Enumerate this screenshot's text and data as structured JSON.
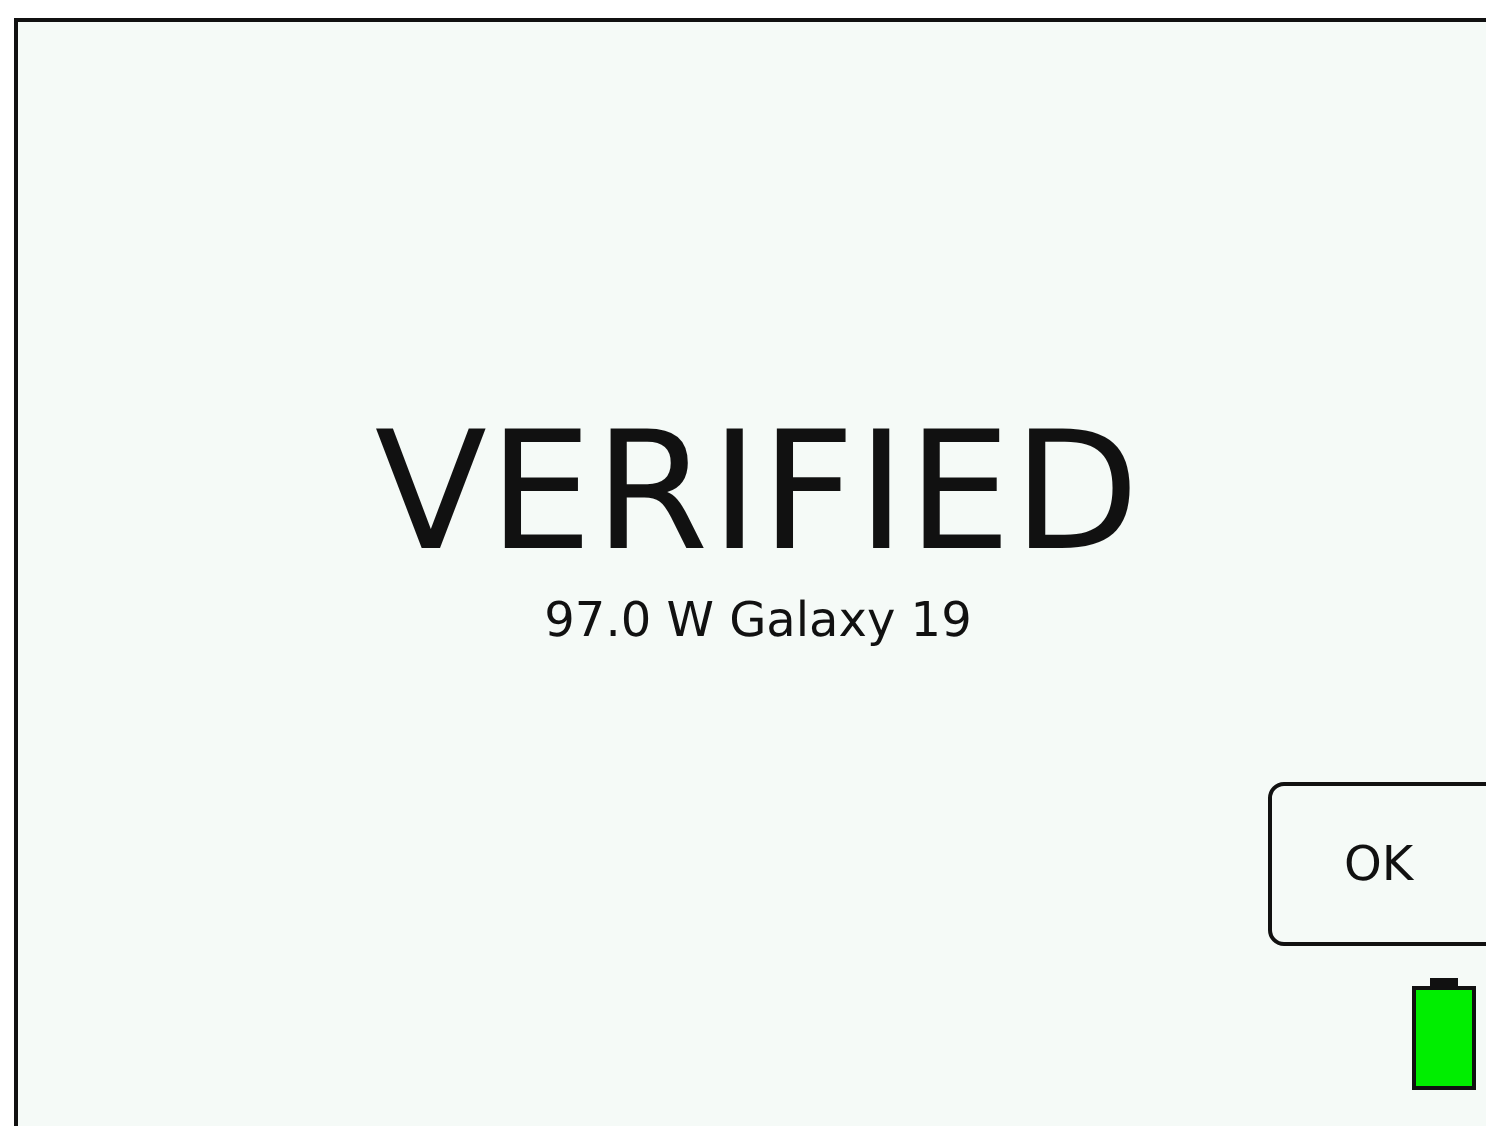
{
  "status": {
    "title": "VERIFIED",
    "detail": "97.0 W Galaxy 19"
  },
  "buttons": [
    {
      "label": "OK"
    }
  ]
}
